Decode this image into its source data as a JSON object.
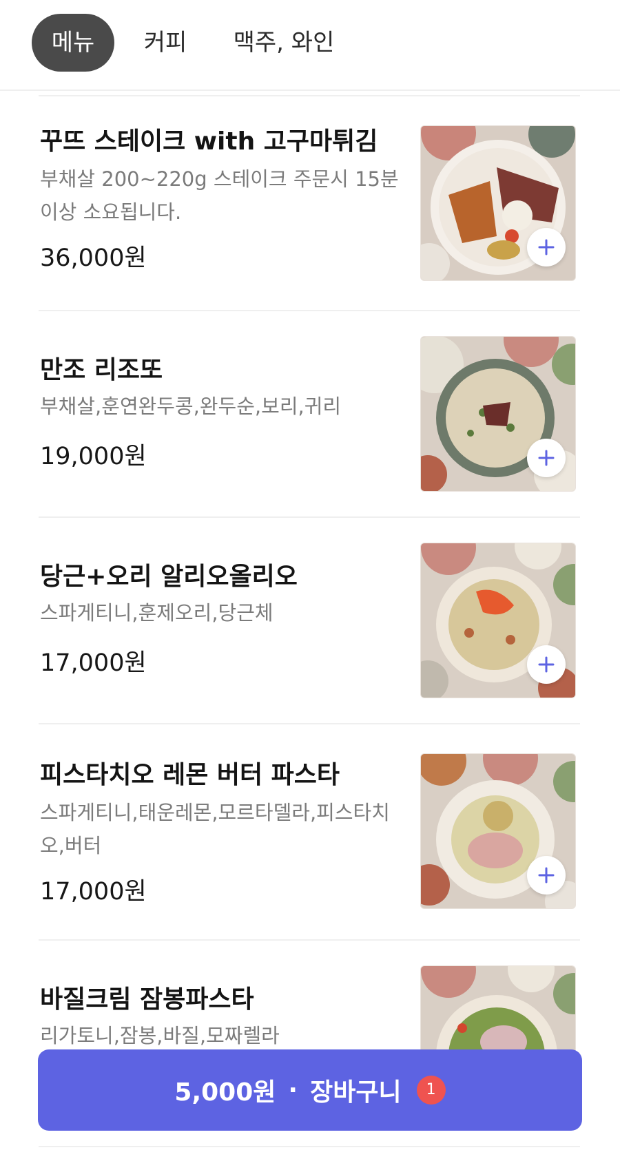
{
  "tabs": [
    {
      "label": "메뉴",
      "active": true
    },
    {
      "label": "커피",
      "active": false
    },
    {
      "label": "맥주, 와인",
      "active": false
    }
  ],
  "menu_items": [
    {
      "name": "꾸뜨 스테이크 with 고구마튀김",
      "description": "부채살 200~220g 스테이크 주문시 15분 이상 소요됩니다.",
      "price": "36,000원",
      "image": "steak-with-fries-dish"
    },
    {
      "name": "만조 리조또",
      "description": "부채살,훈연완두콩,완두순,보리,귀리",
      "price": "19,000원",
      "image": "risotto-dish"
    },
    {
      "name": "당근+오리 알리오올리오",
      "description": "스파게티니,훈제오리,당근체",
      "price": "17,000원",
      "image": "carrot-duck-pasta-dish"
    },
    {
      "name": "피스타치오 레몬 버터 파스타",
      "description": "스파게티니,태운레몬,모르타델라,피스타치오,버터",
      "price": "17,000원",
      "image": "pistachio-lemon-pasta-dish"
    },
    {
      "name": "바질크림 잠봉파스타",
      "description": "리가토니,잠봉,바질,모짜렐라",
      "price": "",
      "image": "basil-cream-pasta-dish"
    }
  ],
  "add_icon": "plus-icon",
  "cart": {
    "amount": "5,000원",
    "separator": "·",
    "label": "장바구니",
    "count": "1"
  },
  "colors": {
    "accent": "#5d63e2",
    "active_tab": "#4a4a4a",
    "badge": "#ef5350"
  }
}
